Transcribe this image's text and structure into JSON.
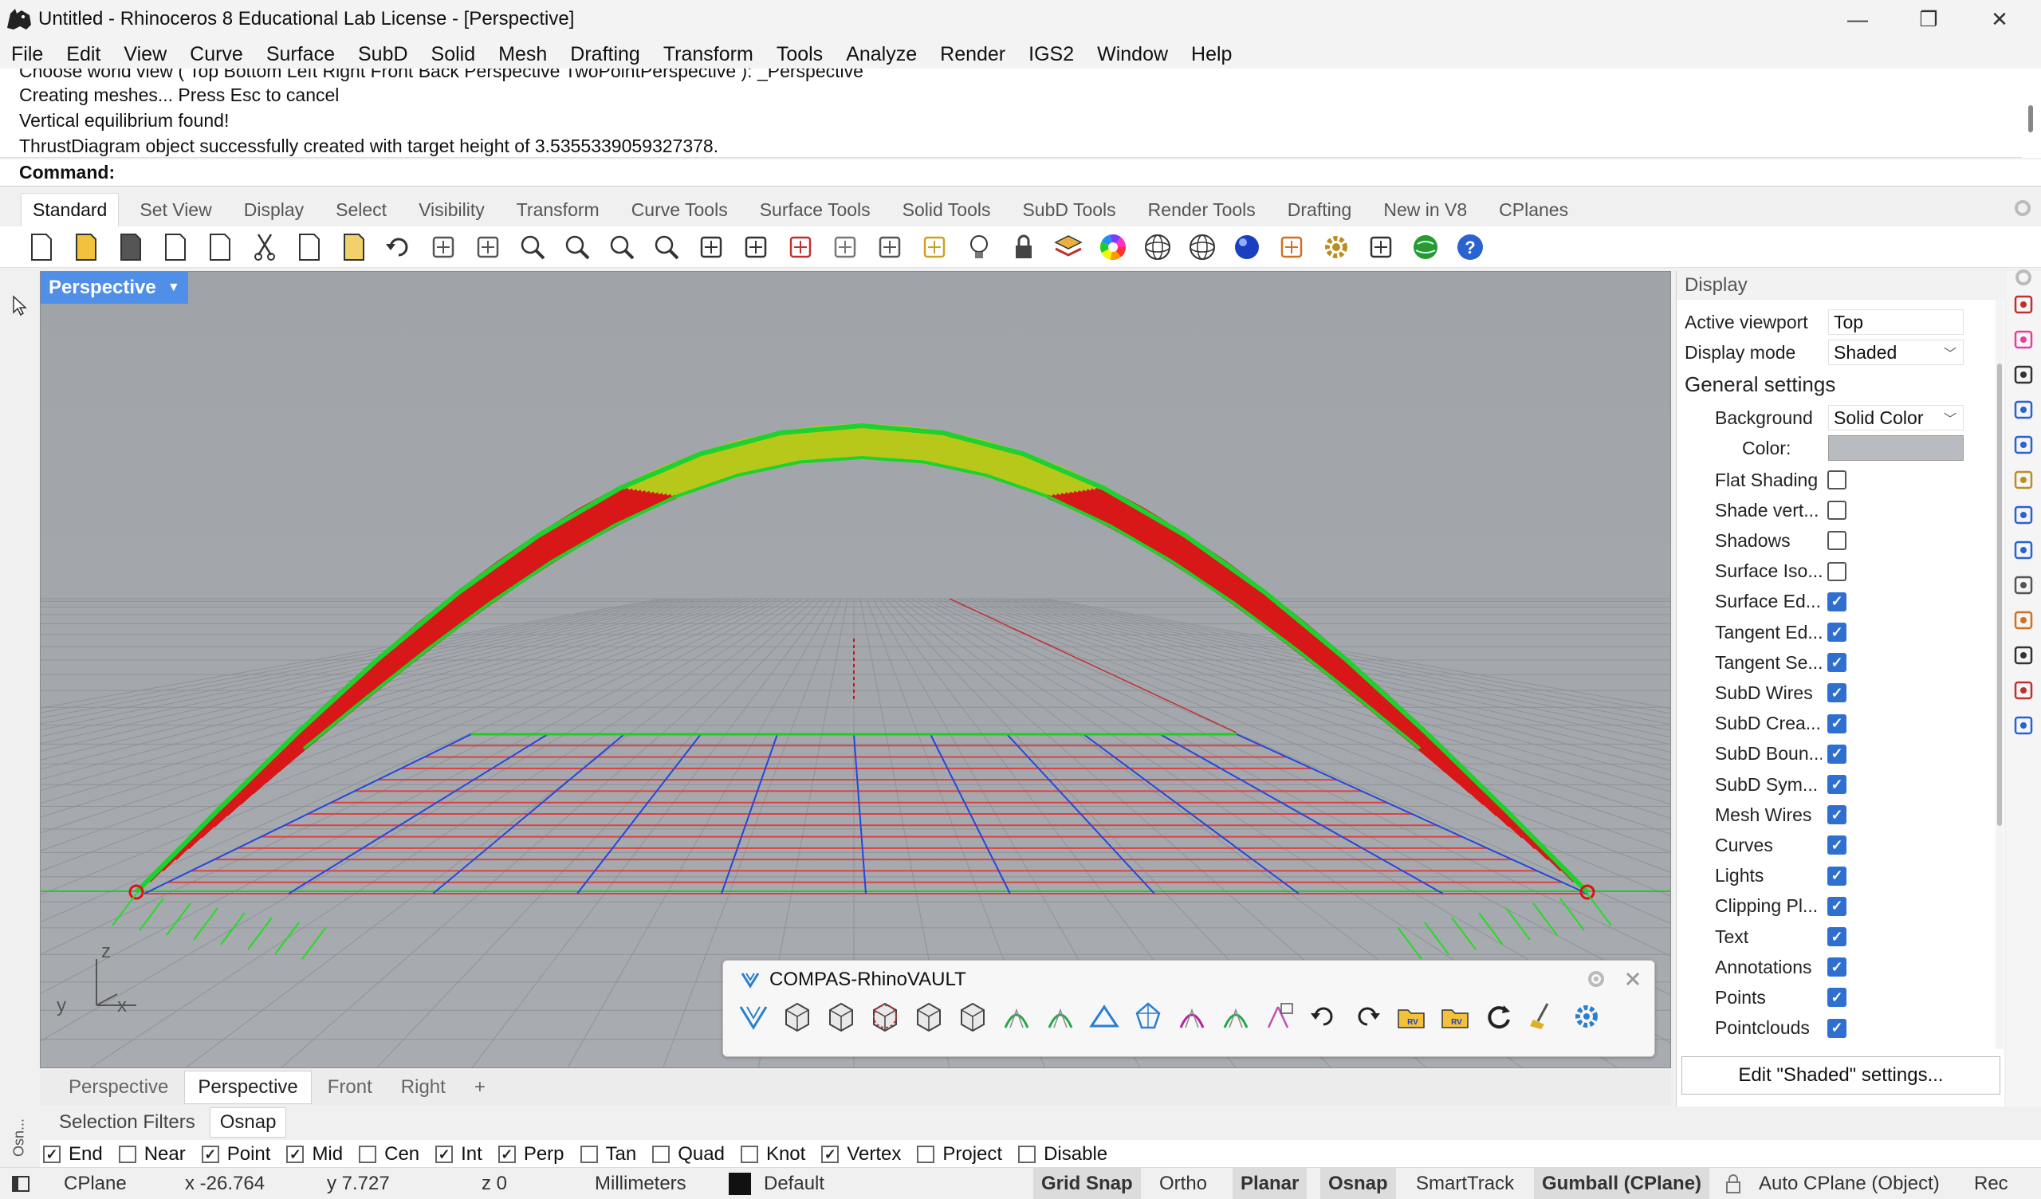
{
  "window": {
    "title": "Untitled - Rhinoceros 8 Educational Lab License - [Perspective]",
    "minimize": "—",
    "restore": "❐",
    "close": "✕"
  },
  "menu": [
    "File",
    "Edit",
    "View",
    "Curve",
    "Surface",
    "SubD",
    "Solid",
    "Mesh",
    "Drafting",
    "Transform",
    "Tools",
    "Analyze",
    "Render",
    "IGS2",
    "Window",
    "Help"
  ],
  "command_history": [
    "Choose world view ( Top  Bottom  Left  Right  Front  Back  Perspective  TwoPointPerspective ): _Perspective",
    "Creating meshes... Press Esc to cancel",
    "Vertical equilibrium found!",
    "ThrustDiagram object successfully created with target height of 3.5355339059327378."
  ],
  "command_prompt": "Command:",
  "command_value": "",
  "toolbar_tabs": [
    "Standard",
    "Set View",
    "Display",
    "Select",
    "Visibility",
    "Transform",
    "Curve Tools",
    "Surface Tools",
    "Solid Tools",
    "SubD Tools",
    "Render Tools",
    "Drafting",
    "New in V8",
    "CPlanes"
  ],
  "toolbar_tools": [
    "new-file",
    "open-folder",
    "save",
    "print",
    "import",
    "cut",
    "copy",
    "paste",
    "undo",
    "pan-hand",
    "rotate-view",
    "zoom",
    "zoom-window",
    "zoom-extents",
    "zoom-selected",
    "rotate-view-alt",
    "four-viewports",
    "car-object",
    "grid",
    "point",
    "snap-points",
    "bulb-light",
    "lock",
    "layer",
    "color-wheel",
    "sphere-wireframe",
    "sphere-grid",
    "render-sphere",
    "sun-dim",
    "gear-settings",
    "dimension",
    "globe-render",
    "help"
  ],
  "viewport": {
    "title": "Perspective",
    "axis_labels": {
      "z": "z",
      "y": "y",
      "x": "x"
    }
  },
  "viewport_tabs": [
    "Perspective",
    "Perspective",
    "Front",
    "Right"
  ],
  "viewport_tab_add": "+",
  "compas": {
    "title": "COMPAS-RhinoVAULT",
    "tools": [
      "rv-logo",
      "pattern-box",
      "pattern-grid",
      "pattern-mesh",
      "pattern-triangle",
      "pattern-star",
      "boundaries",
      "form-diagram",
      "supports",
      "force-diagram",
      "thrust-diagram",
      "openings",
      "constraints",
      "undo",
      "redo",
      "open-file",
      "save-file",
      "refresh",
      "clean",
      "settings"
    ]
  },
  "display_panel": {
    "header": "Display",
    "active_viewport_label": "Active viewport",
    "active_viewport": "Top",
    "display_mode_label": "Display mode",
    "display_mode": "Shaded",
    "general_settings": "General settings",
    "background_label": "Background",
    "background": "Solid Color",
    "color_label": "Color:",
    "color_swatch": "#b8bbc0",
    "checkboxes": [
      {
        "label": "Flat Shading",
        "checked": false
      },
      {
        "label": "Shade vert...",
        "checked": false
      },
      {
        "label": "Shadows",
        "checked": false
      },
      {
        "label": "Surface Iso...",
        "checked": false
      },
      {
        "label": "Surface Ed...",
        "checked": true
      },
      {
        "label": "Tangent Ed...",
        "checked": true
      },
      {
        "label": "Tangent Se...",
        "checked": true
      },
      {
        "label": "SubD Wires",
        "checked": true
      },
      {
        "label": "SubD Crea...",
        "checked": true
      },
      {
        "label": "SubD Boun...",
        "checked": true
      },
      {
        "label": "SubD Sym...",
        "checked": true
      },
      {
        "label": "Mesh Wires",
        "checked": true
      },
      {
        "label": "Curves",
        "checked": true
      },
      {
        "label": "Lights",
        "checked": true
      },
      {
        "label": "Clipping Pl...",
        "checked": true
      },
      {
        "label": "Text",
        "checked": true
      },
      {
        "label": "Annotations",
        "checked": true
      },
      {
        "label": "Points",
        "checked": true
      },
      {
        "label": "Pointclouds",
        "checked": true
      }
    ],
    "edit_button": "Edit \"Shaded\" settings..."
  },
  "osnap_tabs": [
    "Selection Filters",
    "Osnap"
  ],
  "osnap_items": [
    {
      "label": "End",
      "checked": true
    },
    {
      "label": "Near",
      "checked": false
    },
    {
      "label": "Point",
      "checked": true
    },
    {
      "label": "Mid",
      "checked": true
    },
    {
      "label": "Cen",
      "checked": false
    },
    {
      "label": "Int",
      "checked": true
    },
    {
      "label": "Perp",
      "checked": true
    },
    {
      "label": "Tan",
      "checked": false
    },
    {
      "label": "Quad",
      "checked": false
    },
    {
      "label": "Knot",
      "checked": false
    },
    {
      "label": "Vertex",
      "checked": true
    },
    {
      "label": "Project",
      "checked": false
    },
    {
      "label": "Disable",
      "checked": false
    }
  ],
  "status": {
    "cplane": "CPlane",
    "x": "x -26.764",
    "y": "y 7.727",
    "z": "z 0",
    "units": "Millimeters",
    "layer": "Default",
    "grid_snap": "Grid Snap",
    "ortho": "Ortho",
    "planar": "Planar",
    "osnap": "Osnap",
    "smarttrack": "SmartTrack",
    "gumball": "Gumball (CPlane)",
    "auto_cplane": "Auto CPlane (Object)",
    "record": "Rec"
  },
  "colors": {
    "viewport_bg": "#a4a8ad",
    "viewport_title": "#4f8fe8",
    "thrust_purple": "#3e0a3c",
    "edge_green": "#1fd12f",
    "rib_red": "#d81818",
    "rib_yellow": "#b8c81a",
    "grid_red": "#e04040",
    "grid_blue": "#2448d8"
  }
}
